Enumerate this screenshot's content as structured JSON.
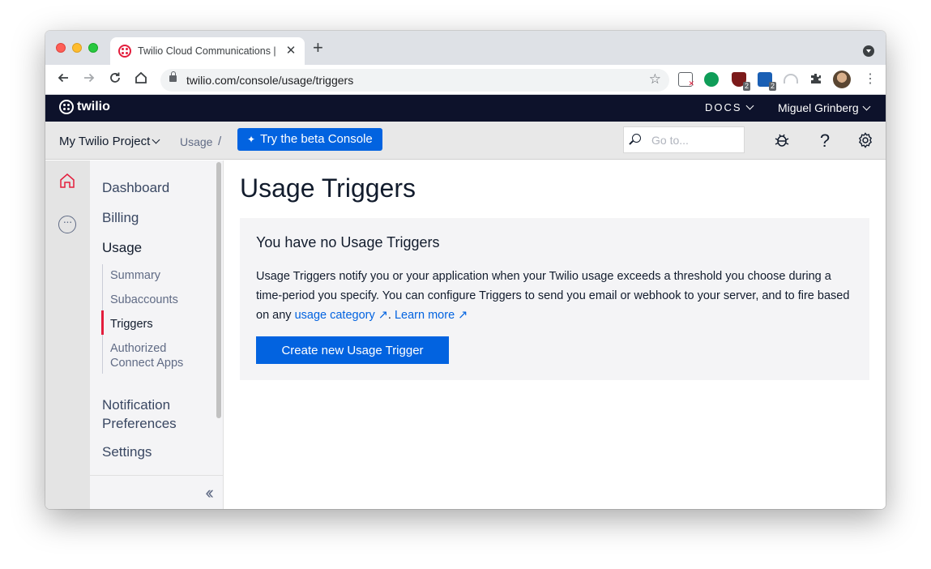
{
  "browser": {
    "tab_title": "Twilio Cloud Communications |",
    "url": "twilio.com/console/usage/triggers",
    "ext_badges": [
      "2",
      "2"
    ]
  },
  "header": {
    "brand": "twilio",
    "docs_label": "DOCS",
    "user_name": "Miguel Grinberg"
  },
  "project_bar": {
    "project_name": "My Twilio Project",
    "breadcrumb": "Usage",
    "breadcrumb_sep": "/",
    "beta_button": "Try the beta Console",
    "goto_placeholder": "Go to..."
  },
  "sidenav": {
    "dashboard": "Dashboard",
    "billing": "Billing",
    "usage": "Usage",
    "sub": {
      "summary": "Summary",
      "subaccounts": "Subaccounts",
      "triggers": "Triggers",
      "authorized_line1": "Authorized",
      "authorized_line2": "Connect Apps"
    },
    "notification_line1": "Notification",
    "notification_line2": "Preferences",
    "settings": "Settings"
  },
  "main": {
    "page_title": "Usage Triggers",
    "card_title": "You have no Usage Triggers",
    "body_text": "Usage Triggers notify you or your application when your Twilio usage exceeds a threshold you choose during a time-period you specify. You can configure Triggers to send you email or webhook to your server, and to fire based on any",
    "link_usage_category": "usage category",
    "link_learn_more": "Learn more",
    "create_button": "Create new Usage Trigger"
  },
  "colors": {
    "brand_red": "#e31e3d",
    "primary_blue": "#0263e0",
    "header_navy": "#0d122b"
  }
}
